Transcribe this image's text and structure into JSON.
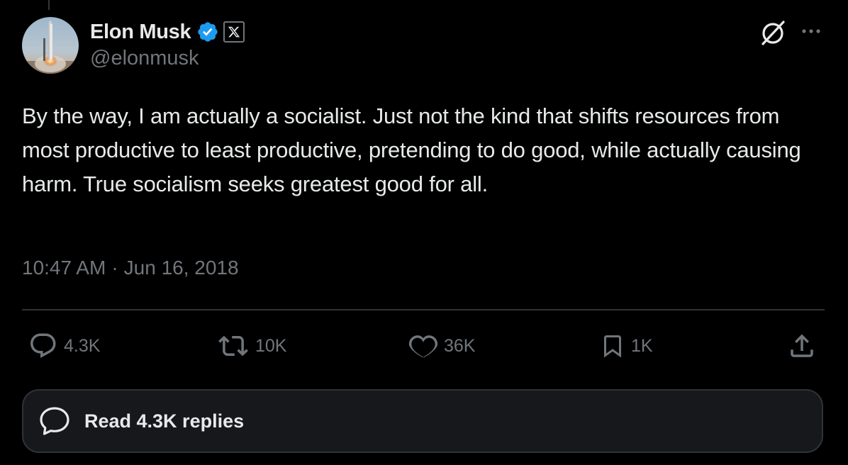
{
  "author": {
    "name": "Elon Musk",
    "handle": "@elonmusk",
    "verified_icon": "verified-badge-icon",
    "affiliate_icon": "x-logo-icon",
    "avatar_icon": "rocket-launch-avatar"
  },
  "header_actions": {
    "grok_icon": "grok-icon",
    "more_icon": "more-dots-icon"
  },
  "tweet": {
    "text": "By the way, I am actually a socialist. Just not the kind that shifts resources from most productive to least productive, pretending to do good, while actually causing harm. True socialism seeks greatest good for all.",
    "time": "10:47 AM",
    "separator": "·",
    "date": "Jun 16, 2018"
  },
  "actions": {
    "replies": {
      "count": "4.3K",
      "icon": "reply-icon"
    },
    "retweets": {
      "count": "10K",
      "icon": "retweet-icon"
    },
    "likes": {
      "count": "36K",
      "icon": "heart-icon"
    },
    "bookmarks": {
      "count": "1K",
      "icon": "bookmark-icon"
    },
    "share": {
      "icon": "share-icon"
    }
  },
  "read_replies": {
    "label": "Read 4.3K replies",
    "icon": "chat-bubble-icon"
  },
  "colors": {
    "background": "#000000",
    "text_primary": "#e7e9ea",
    "text_secondary": "#71767b",
    "verified_blue": "#1d9bf0",
    "divider": "#2f3336",
    "card_bg": "#16181c"
  }
}
